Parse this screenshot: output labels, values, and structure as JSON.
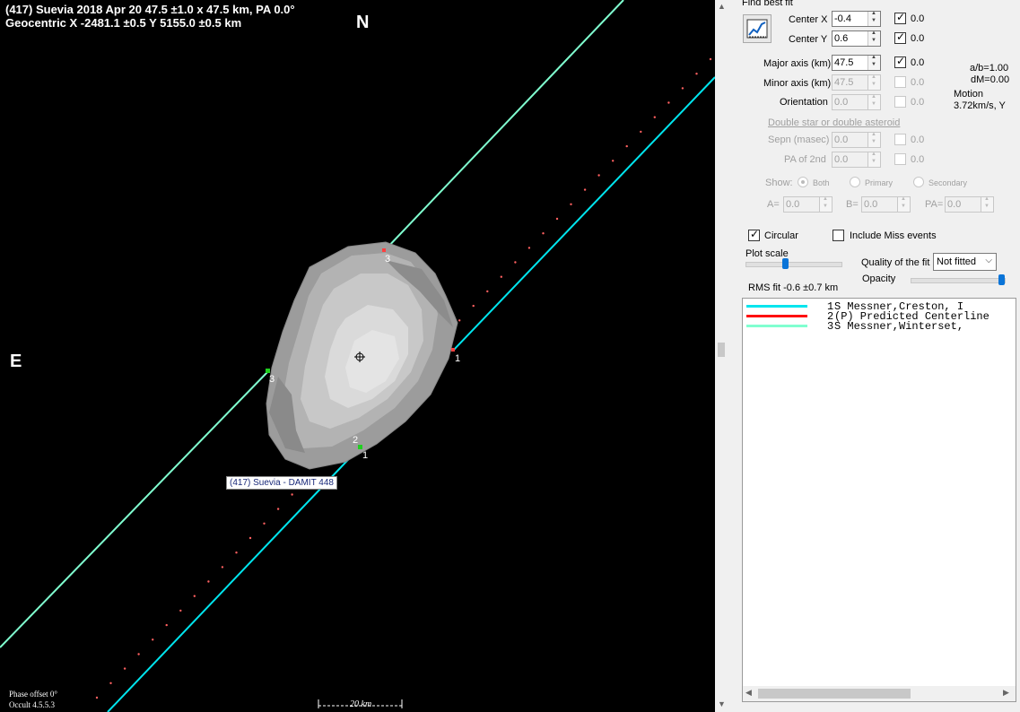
{
  "plot": {
    "title_line1": "(417) Suevia  2018 Apr 20   47.5 ±1.0 x 47.5 km,  PA 0.0°",
    "title_line2": "Geocentric  X  -2481.1 ±0.5  Y 5155.0 ±0.5 km",
    "north": "N",
    "east": "E",
    "shape_label": "(417) Suevia - DAMIT 448",
    "chord_labels": {
      "c3_top": "3",
      "c3_left": "3",
      "c1_right": "1",
      "c1_bottom": "1",
      "c2": "2"
    },
    "phase_offset": "Phase offset 0°",
    "version": "Occult 4.5.5.3",
    "scale": "20 km",
    "colors": {
      "chord1": "#00e5ee",
      "chord3": "#80ffd0",
      "predicted": "#ff6060",
      "shape": "#c0c0c0"
    }
  },
  "panel": {
    "find_best_fit": "Find best fit",
    "center_x": {
      "label": "Center X",
      "value": "-0.4",
      "checked": true,
      "step": "0.0"
    },
    "center_y": {
      "label": "Center Y",
      "value": "0.6",
      "checked": true,
      "step": "0.0"
    },
    "major_axis": {
      "label": "Major axis (km)",
      "value": "47.5",
      "checked": true,
      "step": "0.0"
    },
    "minor_axis": {
      "label": "Minor axis (km)",
      "value": "47.5",
      "step": "0.0"
    },
    "orientation": {
      "label": "Orientation",
      "value": "0.0",
      "step": "0.0"
    },
    "ab": "a/b=1.00",
    "dm": "dM=0.00",
    "motion_label": "Motion",
    "motion_value": "3.72km/s, Y",
    "double_star": "Double star  or  double asteroid",
    "sepn": {
      "label": "Sepn (masec)",
      "value": "0.0",
      "step": "0.0"
    },
    "pa2": {
      "label": "PA of 2nd",
      "value": "0.0",
      "step": "0.0"
    },
    "show": {
      "label": "Show:",
      "both": "Both",
      "primary": "Primary",
      "secondary": "Secondary"
    },
    "a_field": {
      "label": "A=",
      "value": "0.0"
    },
    "b_field": {
      "label": "B=",
      "value": "0.0"
    },
    "pa_field": {
      "label": "PA=",
      "value": "0.0"
    },
    "circular": {
      "label": "Circular",
      "checked": true
    },
    "include_miss": {
      "label": "Include Miss events",
      "checked": false
    },
    "plot_scale": "Plot scale",
    "quality_label": "Quality of the fit",
    "quality_value": "Not fitted",
    "opacity": "Opacity",
    "rms_fit": "RMS fit -0.6 ±0.7 km",
    "legend": [
      {
        "num": "1",
        "text": "   S Messner,Creston, I",
        "color": "#00e5ee"
      },
      {
        "num": "2",
        "text": "(P) Predicted Centerline",
        "color": "#ff1010"
      },
      {
        "num": "3",
        "text": "   S Messner,Winterset,",
        "color": "#80ffd0"
      }
    ]
  }
}
